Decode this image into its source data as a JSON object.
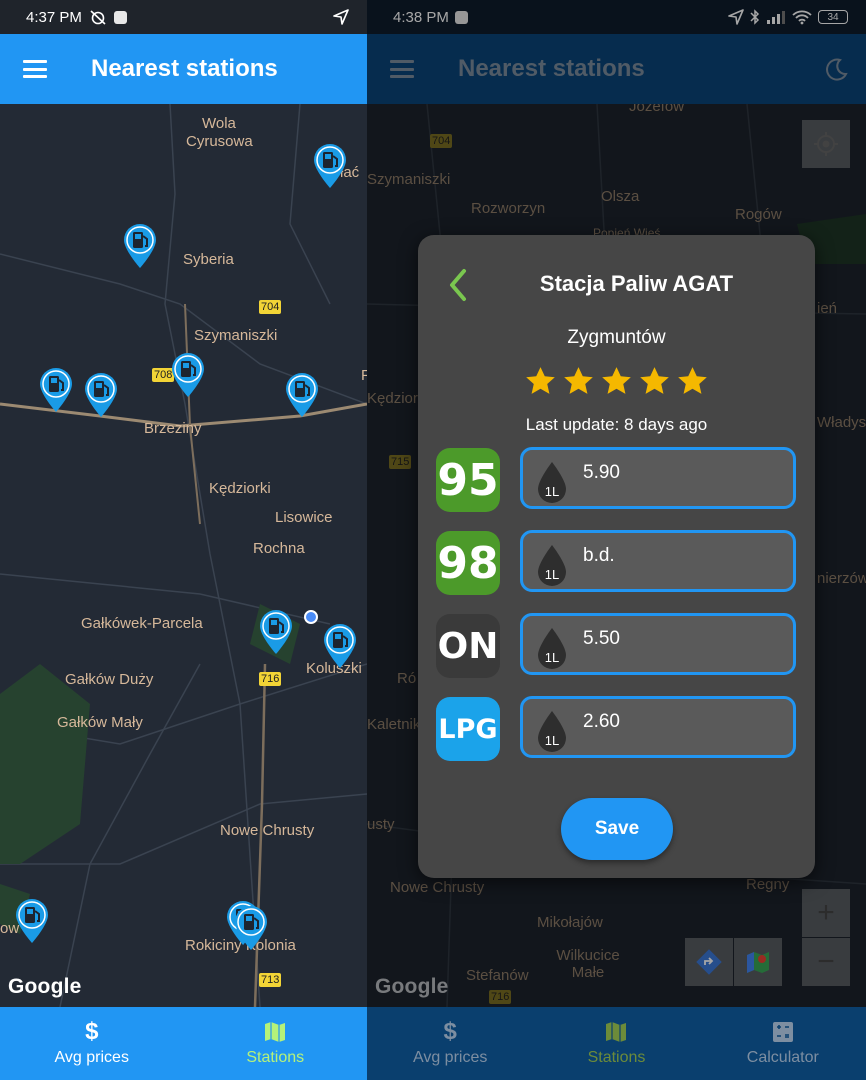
{
  "left": {
    "status": {
      "time": "4:37 PM"
    },
    "app_bar": {
      "title": "Nearest stations"
    },
    "map": {
      "places": [
        "Wola",
        "Cyrusowa",
        "Syberia",
        "Szymaniszki",
        "Brzeziny",
        "Kędziorki",
        "Lisowice",
        "Rochna",
        "Gałkówek-Parcela",
        "Gałków Duży",
        "Gałków Mały",
        "Koluszki",
        "Nowe Chrusty",
        "Rokiciny Kolonia",
        "ow",
        "łać",
        "F"
      ],
      "road_numbers": [
        "704",
        "708",
        "716",
        "713"
      ],
      "attribution": "Google"
    },
    "bottom_nav": {
      "avg_prices": "Avg prices",
      "stations": "Stations"
    }
  },
  "right": {
    "status": {
      "time": "4:38 PM",
      "battery": "34"
    },
    "app_bar": {
      "title": "Nearest stations"
    },
    "map": {
      "places": [
        "Józefów",
        "Szymaniszki",
        "Rozworzyn",
        "Olsza",
        "Rogów",
        "Kędzior",
        "Nowe Chrusty",
        "Mikołajów",
        "Wilkucice Małe",
        "Stefanów",
        "Regny",
        "Władysła",
        "Ró",
        "Kaletnik",
        "usty",
        "ień",
        "nierzów",
        "Popień Wieś"
      ],
      "road_numbers": [
        "704",
        "715",
        "716"
      ],
      "attribution": "Google"
    },
    "dialog": {
      "title": "Stacja Paliw AGAT",
      "city": "Zygmuntów",
      "rating": 5,
      "rating_max": 5,
      "last_update": "Last update: 8 days ago",
      "unit": "1L",
      "fuels": [
        {
          "label": "95",
          "value": "5.90",
          "color": "#4c9a2a"
        },
        {
          "label": "98",
          "value": "b.d.",
          "color": "#4c9a2a"
        },
        {
          "label": "ON",
          "value": "5.50",
          "color": "#3a3a3a"
        },
        {
          "label": "LPG",
          "value": "2.60",
          "color": "#1ba3ea"
        }
      ],
      "save_label": "Save"
    },
    "bottom_nav": {
      "avg_prices": "Avg prices",
      "stations": "Stations",
      "calculator": "Calculator"
    }
  },
  "colors": {
    "primary": "#2196f3",
    "active_nav": "#b5f27a",
    "star": "#f5b800",
    "pin": "#1a9be6"
  }
}
